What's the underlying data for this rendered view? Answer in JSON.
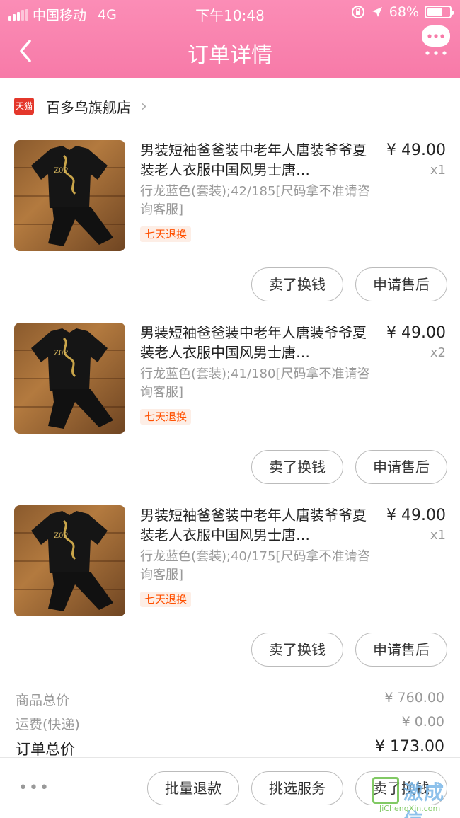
{
  "status_bar": {
    "carrier": "中国移动",
    "network": "4G",
    "time": "下午10:48",
    "battery": "68%",
    "battery_level": 0.68
  },
  "header": {
    "title": "订单详情",
    "back_icon": "chevron-left-icon",
    "message_icon": "chat-bubble-icon"
  },
  "shop": {
    "badge": "天猫",
    "name": "百多鸟旗舰店"
  },
  "items": [
    {
      "title": "男装短袖爸爸装中老年人唐装爷爷夏装老人衣服中国风男士唐…",
      "sku": "行龙蓝色(套装);42/185[尺码拿不准请咨询客服]",
      "tag": "七天退换",
      "price": "¥ 49.00",
      "qty": "x1",
      "btn_sell": "卖了换钱",
      "btn_after": "申请售后"
    },
    {
      "title": "男装短袖爸爸装中老年人唐装爷爷夏装老人衣服中国风男士唐…",
      "sku": "行龙蓝色(套装);41/180[尺码拿不准请咨询客服]",
      "tag": "七天退换",
      "price": "¥ 49.00",
      "qty": "x2",
      "btn_sell": "卖了换钱",
      "btn_after": "申请售后"
    },
    {
      "title": "男装短袖爸爸装中老年人唐装爷爷夏装老人衣服中国风男士唐…",
      "sku": "行龙蓝色(套装);40/175[尺码拿不准请咨询客服]",
      "tag": "七天退换",
      "price": "¥ 49.00",
      "qty": "x1",
      "btn_sell": "卖了换钱",
      "btn_after": "申请售后"
    }
  ],
  "summary": {
    "goods_label": "商品总价",
    "goods_value": "¥ 760.00",
    "shipping_label": "运费(快递)",
    "shipping_value": "¥ 0.00",
    "total_label": "订单总价",
    "total_value": "¥ 173.00"
  },
  "bottom_bar": {
    "more": "•••",
    "refund": "批量退款",
    "service": "挑选服务",
    "sell": "卖了换钱"
  },
  "watermark": {
    "text": "jichengxin",
    "url": "JiChengXin.com"
  }
}
